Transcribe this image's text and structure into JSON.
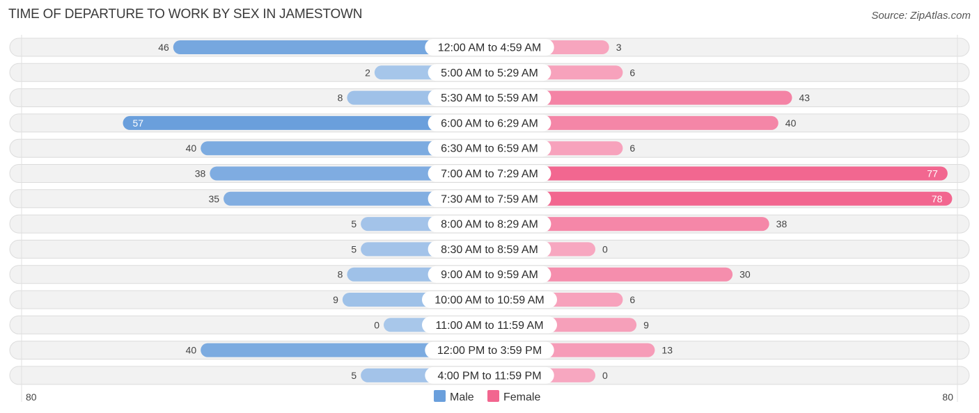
{
  "title": "TIME OF DEPARTURE TO WORK BY SEX IN JAMESTOWN",
  "source": "Source: ZipAtlas.com",
  "colors": {
    "male": "#6a9fdc",
    "male_light": "#a8c7ea",
    "female": "#f2668f",
    "female_light": "#f7a7c0"
  },
  "chart_data": {
    "type": "bar",
    "orientation": "horizontal-diverging",
    "title": "TIME OF DEPARTURE TO WORK BY SEX IN JAMESTOWN",
    "categories": [
      "12:00 AM to 4:59 AM",
      "5:00 AM to 5:29 AM",
      "5:30 AM to 5:59 AM",
      "6:00 AM to 6:29 AM",
      "6:30 AM to 6:59 AM",
      "7:00 AM to 7:29 AM",
      "7:30 AM to 7:59 AM",
      "8:00 AM to 8:29 AM",
      "8:30 AM to 8:59 AM",
      "9:00 AM to 9:59 AM",
      "10:00 AM to 10:59 AM",
      "11:00 AM to 11:59 AM",
      "12:00 PM to 3:59 PM",
      "4:00 PM to 11:59 PM"
    ],
    "series": [
      {
        "name": "Male",
        "values": [
          46,
          2,
          8,
          57,
          40,
          38,
          35,
          5,
          5,
          8,
          9,
          0,
          40,
          5
        ]
      },
      {
        "name": "Female",
        "values": [
          3,
          6,
          43,
          40,
          6,
          77,
          78,
          38,
          0,
          30,
          6,
          9,
          13,
          0
        ]
      }
    ],
    "axis": {
      "left_label": "80",
      "right_label": "80",
      "max": 80
    },
    "legend": {
      "position": "bottom-center",
      "items": [
        "Male",
        "Female"
      ]
    }
  }
}
